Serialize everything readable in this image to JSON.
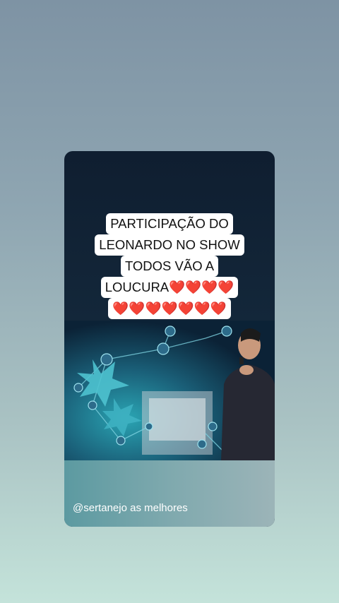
{
  "post": {
    "caption_line1": "PARTICIPAÇÃO DO",
    "caption_line2": "LEONARDO NO SHOW",
    "caption_line3": "TODOS VÃO A",
    "caption_line4_text": "LOUCURA",
    "caption_line4_hearts": "❤️❤️❤️❤️",
    "caption_line5_hearts": "❤️❤️❤️❤️❤️❤️❤️",
    "handle": "@sertanejo as melhores"
  },
  "colors": {
    "heart": "#d3121f",
    "caption_bg": "#ffffff"
  }
}
